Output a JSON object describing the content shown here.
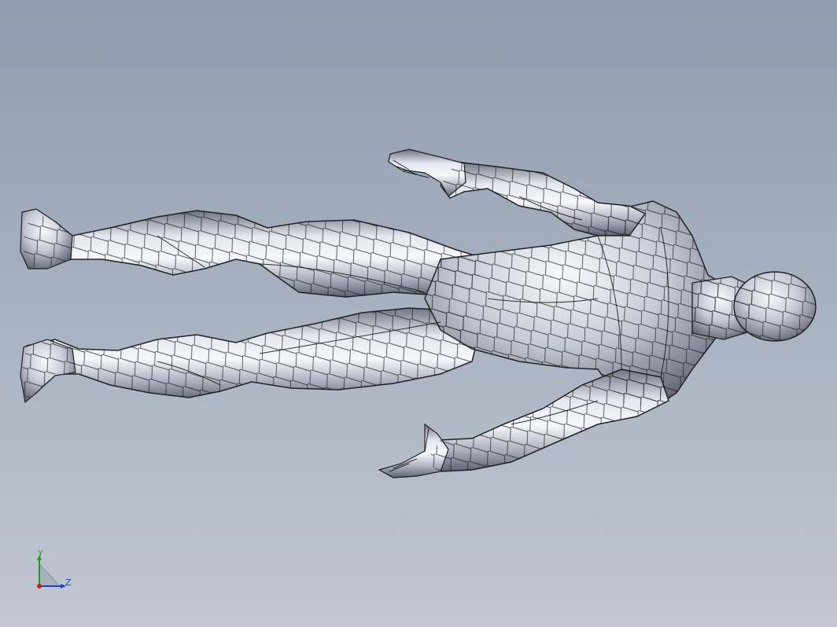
{
  "viewport": {
    "background_top": "#8e9cad",
    "background_bottom": "#c1c6d2",
    "model": {
      "name": "human-figure-surface-model",
      "surface_color": "#c8ccd8",
      "mesh_line_color": "#111111",
      "display_mode": "shaded-with-edges"
    }
  },
  "triad": {
    "y_label": "Y",
    "z_label": "Z",
    "y_color": "#1aa31a",
    "z_color": "#1d3fd1",
    "x_color": "#d01a1a"
  }
}
